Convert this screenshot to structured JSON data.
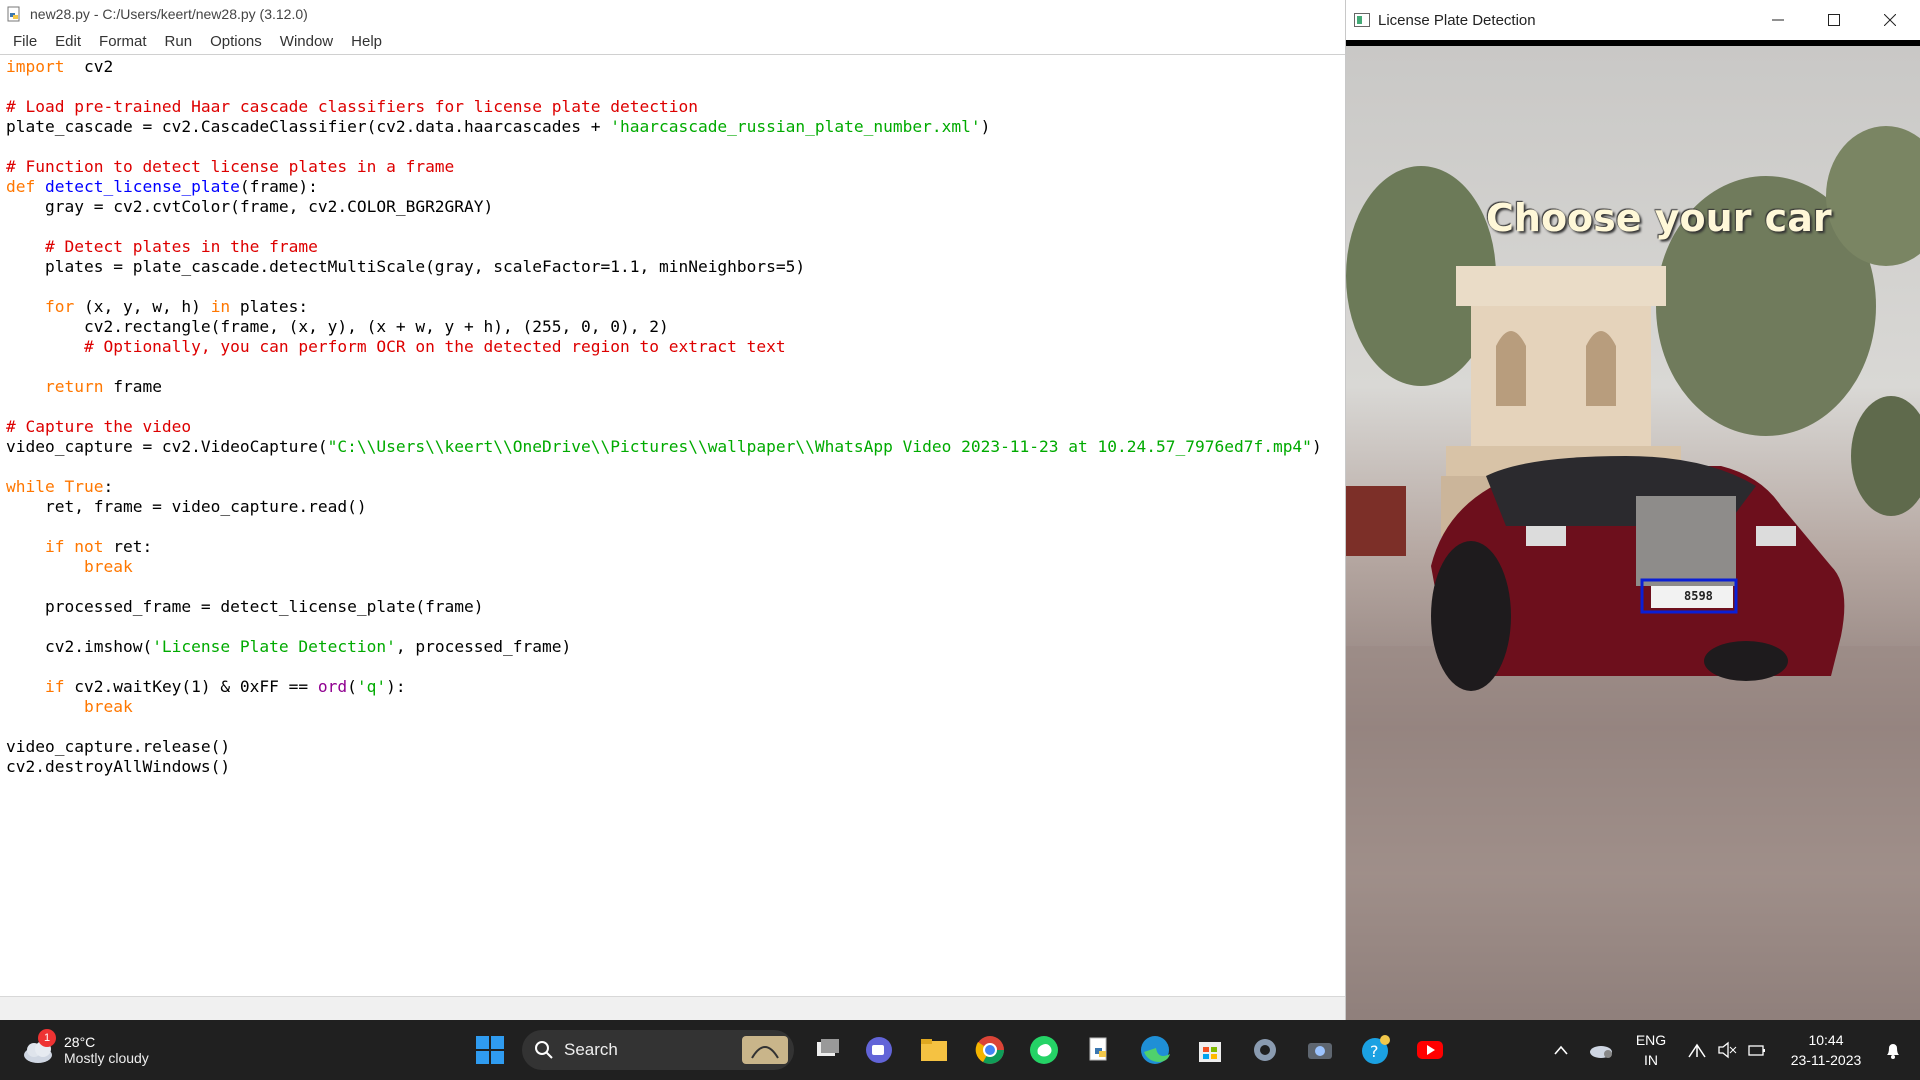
{
  "idle": {
    "title": "new28.py - C:/Users/keert/new28.py (3.12.0)",
    "menu": [
      "File",
      "Edit",
      "Format",
      "Run",
      "Options",
      "Window",
      "Help"
    ],
    "code": [
      [
        [
          "kw",
          "import"
        ],
        [
          "",
          "  cv2"
        ]
      ],
      [],
      [
        [
          "cm",
          "# Load pre-trained Haar cascade classifiers for license plate detection"
        ]
      ],
      [
        [
          "",
          "plate_cascade = cv2.CascadeClassifier(cv2.data.haarcascades + "
        ],
        [
          "st",
          "'haarcascade_russian_plate_number.xml'"
        ],
        [
          "",
          ")"
        ]
      ],
      [],
      [
        [
          "cm",
          "# Function to detect license plates in a frame"
        ]
      ],
      [
        [
          "kw",
          "def"
        ],
        [
          "",
          " "
        ],
        [
          "fn",
          "detect_license_plate"
        ],
        [
          "",
          "(frame):"
        ]
      ],
      [
        [
          "",
          "    gray = cv2.cvtColor(frame, cv2.COLOR_BGR2GRAY)"
        ]
      ],
      [],
      [
        [
          "cm",
          "    # Detect plates in the frame"
        ]
      ],
      [
        [
          "",
          "    plates = plate_cascade.detectMultiScale(gray, scaleFactor=1.1, minNeighbors=5)"
        ]
      ],
      [],
      [
        [
          "kw",
          "    for"
        ],
        [
          "",
          " (x, y, w, h) "
        ],
        [
          "kw",
          "in"
        ],
        [
          "",
          " plates:"
        ]
      ],
      [
        [
          "",
          "        cv2.rectangle(frame, (x, y), (x + w, y + h), (255, 0, 0), 2)"
        ]
      ],
      [
        [
          "cm",
          "        # Optionally, you can perform OCR on the detected region to extract text"
        ]
      ],
      [],
      [
        [
          "kw",
          "    return"
        ],
        [
          "",
          " frame"
        ]
      ],
      [],
      [
        [
          "cm",
          "# Capture the video"
        ]
      ],
      [
        [
          "",
          "video_capture = cv2.VideoCapture("
        ],
        [
          "st",
          "\"C:\\\\Users\\\\keert\\\\OneDrive\\\\Pictures\\\\wallpaper\\\\WhatsApp Video 2023-11-23 at 10.24.57_7976ed7f.mp4\""
        ],
        [
          "",
          ")"
        ]
      ],
      [],
      [
        [
          "kw",
          "while"
        ],
        [
          "",
          " "
        ],
        [
          "kw",
          "True"
        ],
        [
          "",
          ":"
        ]
      ],
      [
        [
          "",
          "    ret, frame = video_capture.read()"
        ]
      ],
      [],
      [
        [
          "kw",
          "    if not"
        ],
        [
          "",
          " ret:"
        ]
      ],
      [
        [
          "kw",
          "        break"
        ]
      ],
      [],
      [
        [
          "",
          "    processed_frame = detect_license_plate(frame)"
        ]
      ],
      [],
      [
        [
          "",
          "    cv2.imshow("
        ],
        [
          "st",
          "'License Plate Detection'"
        ],
        [
          "",
          ", processed_frame)"
        ]
      ],
      [],
      [
        [
          "kw",
          "    if"
        ],
        [
          "",
          " cv2.waitKey(1) & 0xFF == "
        ],
        [
          "bi",
          "ord"
        ],
        [
          "",
          "("
        ],
        [
          "st",
          "'q'"
        ],
        [
          "",
          "):"
        ]
      ],
      [
        [
          "kw",
          "        break"
        ]
      ],
      [],
      [
        [
          "",
          "video_capture.release()"
        ]
      ],
      [
        [
          "",
          "cv2.destroyAllWindows()"
        ]
      ]
    ]
  },
  "video_window": {
    "title": "License Plate Detection",
    "overlay_text": "Choose your car",
    "plate_text": "8598",
    "detection_box_color": "#0a1fd6"
  },
  "taskbar": {
    "weather": {
      "temp": "28°C",
      "condition": "Mostly cloudy",
      "badge": "1"
    },
    "search_label": "Search",
    "language": {
      "line1": "ENG",
      "line2": "IN"
    },
    "clock": {
      "time": "10:44",
      "date": "23-11-2023"
    }
  }
}
